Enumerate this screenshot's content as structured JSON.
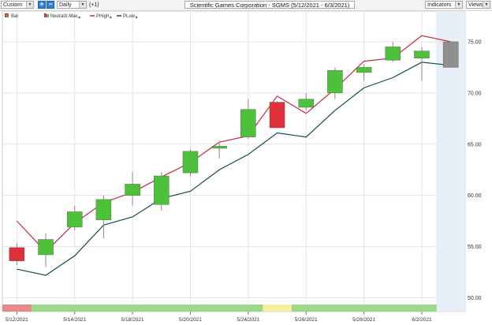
{
  "toolbar": {
    "range_select": "Custom",
    "interval_select": "Daily",
    "offset_label": "(+1)",
    "title": "Scientific Games Corporation - SGMS (5/12/2021 - 6/3/2021)",
    "indicators_label": "Indicators",
    "views_label": "Views"
  },
  "legend": [
    {
      "name": "Bar"
    },
    {
      "name": "NeuralX.Max"
    },
    {
      "name": "PHigh"
    },
    {
      "name": "PLow"
    }
  ],
  "colors": {
    "up": "#4ec13a",
    "down": "#e0303a",
    "forecast": "#8f8f8f",
    "phigh": "#c62a3a",
    "plow": "#0e4f4a",
    "forecast_zone": "#e6eef7",
    "band_red": "#e88888",
    "band_green": "#99d989",
    "band_yellow": "#f5ef9a"
  },
  "chart_data": {
    "type": "candlestick",
    "x_dates": [
      "5/12/2021",
      "5/13/2021",
      "5/14/2021",
      "5/17/2021",
      "5/18/2021",
      "5/19/2021",
      "5/20/2021",
      "5/21/2021",
      "5/24/2021",
      "5/25/2021",
      "5/26/2021",
      "5/27/2021",
      "5/28/2021",
      "6/1/2021",
      "6/2/2021",
      "6/3/2021"
    ],
    "x_tick_labels": [
      "5/12/2021",
      "5/14/2021",
      "5/18/2021",
      "5/20/2021",
      "5/24/2021",
      "5/26/2021",
      "5/28/2021",
      "6/2/2021"
    ],
    "y_ticks": [
      "50.00",
      "55.00",
      "60.00",
      "65.00",
      "70.00",
      "75.00"
    ],
    "ylim": [
      49.5,
      78
    ],
    "candles": [
      {
        "open": 54.9,
        "high": 55.3,
        "low": 53.2,
        "close": 53.6,
        "dir": "down"
      },
      {
        "open": 54.2,
        "high": 56.3,
        "low": 53.0,
        "close": 55.7,
        "dir": "up"
      },
      {
        "open": 56.9,
        "high": 59.0,
        "low": 56.6,
        "close": 58.4,
        "dir": "up"
      },
      {
        "open": 57.6,
        "high": 60.0,
        "low": 55.8,
        "close": 59.6,
        "dir": "up"
      },
      {
        "open": 60.0,
        "high": 62.3,
        "low": 59.0,
        "close": 61.1,
        "dir": "up"
      },
      {
        "open": 59.1,
        "high": 62.3,
        "low": 58.5,
        "close": 61.9,
        "dir": "up"
      },
      {
        "open": 62.2,
        "high": 64.5,
        "low": 61.9,
        "close": 64.3,
        "dir": "up"
      },
      {
        "open": 64.6,
        "high": 65.3,
        "low": 63.6,
        "close": 64.8,
        "dir": "up"
      },
      {
        "open": 65.7,
        "high": 69.4,
        "low": 65.5,
        "close": 68.4,
        "dir": "up"
      },
      {
        "open": 69.1,
        "high": 69.2,
        "low": 66.6,
        "close": 66.6,
        "dir": "down"
      },
      {
        "open": 68.6,
        "high": 70.0,
        "low": 68.3,
        "close": 69.4,
        "dir": "up"
      },
      {
        "open": 70.0,
        "high": 72.5,
        "low": 69.4,
        "close": 72.2,
        "dir": "up"
      },
      {
        "open": 72.0,
        "high": 72.8,
        "low": 71.2,
        "close": 72.5,
        "dir": "up"
      },
      {
        "open": 73.2,
        "high": 75.0,
        "low": 73.0,
        "close": 74.5,
        "dir": "up"
      },
      {
        "open": 73.4,
        "high": 74.5,
        "low": 71.2,
        "close": 74.1,
        "dir": "up"
      },
      {
        "open": 72.5,
        "high": 75.0,
        "low": 72.5,
        "close": 75.0,
        "dir": "forecast"
      }
    ],
    "series": [
      {
        "name": "PHigh",
        "values": [
          57.5,
          54.5,
          57.3,
          59.3,
          60.3,
          61.8,
          63.2,
          65.2,
          65.8,
          69.7,
          68.0,
          70.4,
          73.1,
          73.4,
          75.6,
          75.0
        ]
      },
      {
        "name": "PLow",
        "values": [
          52.8,
          52.2,
          54.1,
          57.1,
          57.9,
          59.7,
          60.4,
          62.5,
          64.0,
          66.1,
          65.7,
          68.3,
          70.5,
          71.5,
          73.0,
          72.7
        ]
      }
    ],
    "signal_band": [
      "red",
      "green",
      "green",
      "green",
      "green",
      "green",
      "green",
      "green",
      "green",
      "yellow",
      "green",
      "green",
      "green",
      "green",
      "green",
      "none"
    ]
  }
}
